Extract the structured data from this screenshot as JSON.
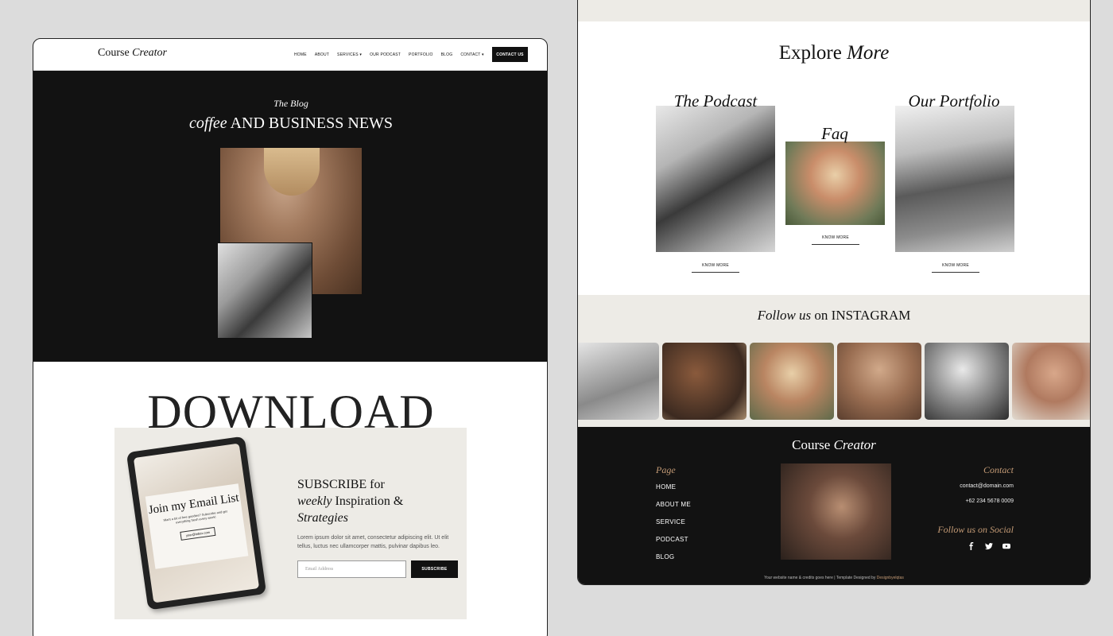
{
  "left": {
    "nav": {
      "logo_plain": "Course",
      "logo_italic": "Creator",
      "links": [
        "HOME",
        "ABOUT",
        "SERVICES ▾",
        "OUR PODCAST",
        "PORTFOLIO",
        "BLOG",
        "CONTACT ▾"
      ],
      "cta": "CONTACT US"
    },
    "hero": {
      "eyebrow": "The Blog",
      "title_italic": "coffee",
      "title_rest": "AND BUSINESS NEWS"
    },
    "download": {
      "title": "DOWNLOAD",
      "tablet_title": "Join my Email List",
      "tablet_body": "Want a bit of free goodies? Subscribe and get everything fresh every week!",
      "tablet_email": "your@Inbox.com",
      "heading_line1": "SUBSCRIBE  for",
      "heading_italic": "weekly",
      "heading_line2": "Inspiration &",
      "heading_line3": "Strategies",
      "text": "Lorem ipsum dolor sit amet, consectetur adipiscing elit. Ut elit tellus, luctus nec ullamcorper mattis, pulvinar dapibus leo.",
      "input_placeholder": "Email Address",
      "button": "SUBSCRIBE"
    }
  },
  "right": {
    "explore": {
      "plain": "Explore",
      "italic": "More"
    },
    "cards": [
      {
        "title": "The Podcast",
        "link": "KNOW MORE"
      },
      {
        "title": "Faq",
        "link": "KNOW MORE"
      },
      {
        "title": "Our Portfolio",
        "link": "KNOW MORE"
      }
    ],
    "instagram": {
      "italic": "Follow us",
      "rest": "on INSTAGRAM"
    },
    "footer": {
      "logo_plain": "Course",
      "logo_italic": "Creator",
      "page_heading": "Page",
      "page_links": [
        "HOME",
        "ABOUT ME",
        "SERVICE",
        "PODCAST",
        "BLOG"
      ],
      "contact_heading": "Contact",
      "email": "contact@domain.com",
      "phone": "+62 234 5678 0009",
      "social_heading": "Follow us on Social",
      "social_icons": [
        "facebook-icon",
        "twitter-icon",
        "youtube-icon"
      ],
      "credit_text": "Your website name & credits goes here | Template Designed by",
      "credit_link": "Designbyelqtas"
    }
  },
  "colors": {
    "dark": "#121212",
    "beige": "#edebe6",
    "accent": "#c39a75"
  }
}
